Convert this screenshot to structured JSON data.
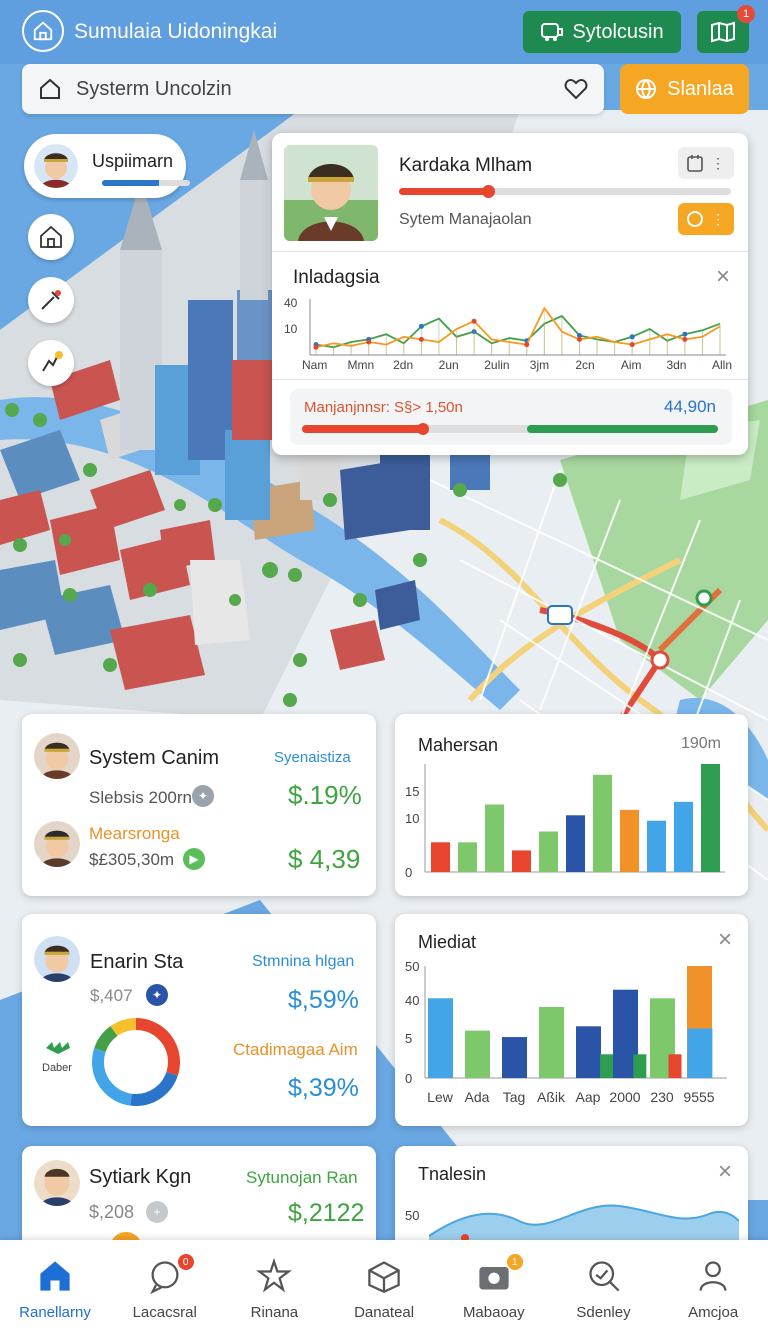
{
  "header": {
    "title": "Sumulaia Uidoningkai",
    "primary_button": "Sytolcusin",
    "map_badge": "1"
  },
  "search": {
    "placeholder": "Systerm Uncolzin",
    "action_button": "Slanlaa"
  },
  "user_pill": {
    "name": "Uspiimarn",
    "progress": 0.65
  },
  "popup": {
    "name": "Kardaka Mlham",
    "subtitle": "Sytem Manajaolan",
    "name_progress": 0.27,
    "chart_title": "Inladagsia",
    "close_label": "×",
    "footer_label": "Manjanjnnsr: S§> 1,50n",
    "footer_value": "44,90n",
    "footer_left_progress": 0.29,
    "footer_right_progress": 0.46
  },
  "cards": {
    "card1": {
      "title": "System Canim",
      "tag": "Syenaistiza",
      "row1_label": "Slebsis 200rn",
      "row1_value": "$.19%",
      "row2_label": "Mearsronga",
      "row2_sub": "$£305,30m",
      "row2_value": "$ 4,39"
    },
    "card2": {
      "title": "Enarin Sta",
      "tag": "Stmnina hlgan",
      "row1_label": "$,407",
      "row1_value": "$,59%",
      "brand_label": "Daber",
      "row2_label": "Ctadimagaa Aim",
      "row2_value": "$,39%",
      "donut_segments": [
        {
          "value": 0.3,
          "color": "#e8452f"
        },
        {
          "value": 0.22,
          "color": "#2a74c9"
        },
        {
          "value": 0.28,
          "color": "#42a5e8"
        },
        {
          "value": 0.1,
          "color": "#43a047"
        },
        {
          "value": 0.1,
          "color": "#f5c02b"
        }
      ]
    },
    "card3": {
      "title": "Sytiark Kgn",
      "tag": "Sytunojan Ran",
      "row1_label": "$,208",
      "row1_value": "$,2122"
    },
    "chart3": {
      "title": "Tnalesin",
      "close_label": "×",
      "tick": "50"
    }
  },
  "chart_data": [
    {
      "type": "line",
      "title": "Inladagsia",
      "x": [
        "Nam",
        "Mmn",
        "2dn",
        "2un",
        "2ulin",
        "3jm",
        "2cn",
        "Aim",
        "3dn",
        "Alln"
      ],
      "y_ticks": [
        "40",
        "10"
      ],
      "series": [
        {
          "values": [
            8,
            6,
            10,
            12,
            16,
            9,
            22,
            28,
            14,
            18,
            9,
            13,
            11,
            24,
            30,
            15,
            12,
            10,
            14,
            20,
            11,
            16,
            19,
            24
          ],
          "color": "#43a047"
        },
        {
          "values": [
            6,
            9,
            7,
            10,
            8,
            14,
            12,
            10,
            20,
            26,
            12,
            10,
            8,
            36,
            18,
            12,
            14,
            10,
            8,
            12,
            16,
            12,
            14,
            22
          ],
          "color": "#f59a23"
        }
      ]
    },
    {
      "type": "bar",
      "title": "Mahersan",
      "header_value": "190m",
      "y_ticks": [
        "15",
        "10",
        "0"
      ],
      "ylim": [
        0,
        20
      ],
      "values": [
        5.5,
        5.5,
        12.5,
        4,
        7.5,
        10.5,
        18,
        11.5,
        9.5,
        13,
        20
      ],
      "colors": [
        "#e8452f",
        "#7dc86a",
        "#7dc86a",
        "#e8452f",
        "#7dc86a",
        "#2a54a8",
        "#7dc86a",
        "#f0912a",
        "#42a5e8",
        "#42a5e8",
        "#2e9d4f"
      ]
    },
    {
      "type": "bar",
      "title": "Miediat",
      "close_label": "×",
      "categories": [
        "Lew",
        "Ada",
        "Tag",
        "Aßik",
        "Aap",
        "2000",
        "230",
        "9555"
      ],
      "y_ticks": [
        "50",
        "40",
        "5",
        "0"
      ],
      "ylim": [
        0,
        52
      ],
      "bars": [
        {
          "x": 0,
          "value": 37,
          "color": "#42a5e8"
        },
        {
          "x": 1,
          "value": 22,
          "color": "#7dc86a"
        },
        {
          "x": 2,
          "value": 19,
          "color": "#2a54a8"
        },
        {
          "x": 3,
          "value": 33,
          "color": "#7dc86a"
        },
        {
          "x": 4,
          "value": 24,
          "color": "#2a54a8"
        },
        {
          "x": 4.65,
          "value": 11,
          "color": "#2e9d4f"
        },
        {
          "x": 5,
          "value": 41,
          "color": "#2a54a8"
        },
        {
          "x": 5.55,
          "value": 11,
          "color": "#2e9d4f"
        },
        {
          "x": 6,
          "value": 37,
          "color": "#7dc86a"
        },
        {
          "x": 6.5,
          "value": 11,
          "color": "#e8452f"
        },
        {
          "x": 7,
          "value": 52,
          "color": "#f0912a"
        },
        {
          "x": 7.01,
          "value": 23,
          "color": "#42a5e8"
        }
      ]
    }
  ],
  "nav": [
    {
      "label": "Ranellarny",
      "icon": "home-icon",
      "active": true
    },
    {
      "label": "Lacacsral",
      "icon": "chat-icon",
      "badge": "0"
    },
    {
      "label": "Rinana",
      "icon": "star-icon"
    },
    {
      "label": "Danateal",
      "icon": "box-icon"
    },
    {
      "label": "Mabaoay",
      "icon": "camera-icon",
      "badge": "1"
    },
    {
      "label": "Sdenley",
      "icon": "search-icon"
    },
    {
      "label": "Amcjoa",
      "icon": "user-icon"
    }
  ],
  "colors": {
    "accent": "#1f8a4f",
    "orange": "#f5a623",
    "blue": "#1d6fd6"
  }
}
